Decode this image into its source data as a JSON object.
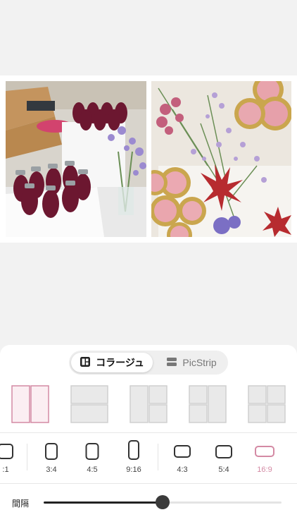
{
  "mode_toggle": {
    "collage_label": "コラージュ",
    "picstrip_label": "PicStrip",
    "selected": "collage"
  },
  "layouts": {
    "selected_index": 0,
    "items": [
      {
        "name": "two-columns"
      },
      {
        "name": "two-rows"
      },
      {
        "name": "left-tall-two-right"
      },
      {
        "name": "left-two-right-tall"
      },
      {
        "name": "four-grid"
      }
    ]
  },
  "aspect_ratios": {
    "selected": "16:9",
    "items": [
      {
        "label": ":1"
      },
      {
        "label": "3:4"
      },
      {
        "label": "4:5"
      },
      {
        "label": "9:16"
      },
      {
        "label": "4:3"
      },
      {
        "label": "5:4"
      },
      {
        "label": "16:9"
      }
    ]
  },
  "spacing": {
    "label": "間隔",
    "value_fraction": 0.5
  },
  "colors": {
    "accent_pink": "#d48aa4",
    "selected_layout_fill": "#fbeef2"
  }
}
